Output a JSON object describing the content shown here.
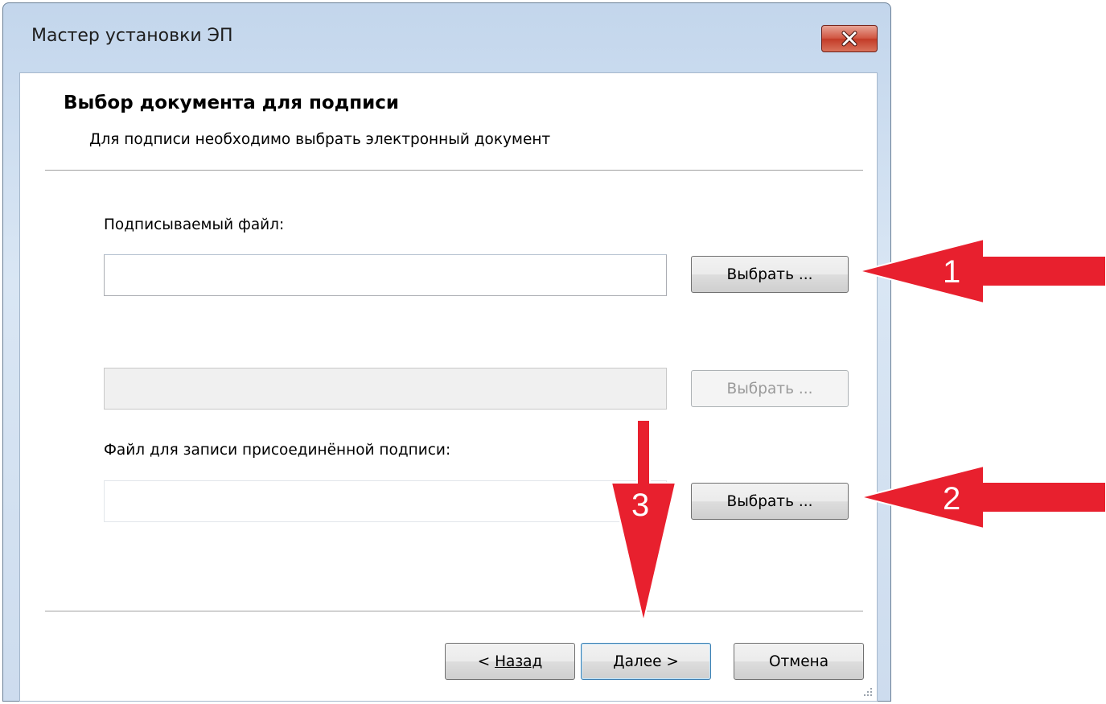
{
  "window": {
    "title": "Мастер установки ЭП",
    "close_glyph": "✕"
  },
  "header": {
    "title": "Выбор документа для подписи",
    "subtitle": "Для подписи необходимо выбрать электронный документ"
  },
  "signed_file": {
    "label": "Подписываемый файл:",
    "value": "",
    "browse_label": "Выбрать ..."
  },
  "second_file": {
    "value": "",
    "browse_label": "Выбрать ...",
    "enabled": false
  },
  "attached_signature_file": {
    "label": "Файл для записи присоединённой подписи:",
    "value": "",
    "browse_label": "Выбрать ..."
  },
  "footer": {
    "back_prefix": "< ",
    "back_underlined": "Н",
    "back_rest": "азад",
    "next_underlined": "Д",
    "next_rest": "алее >",
    "cancel_label": "Отмена"
  },
  "annotations": {
    "color": "#e8202e",
    "arrow_1_number": "1",
    "arrow_2_number": "2",
    "arrow_3_number": "3"
  }
}
